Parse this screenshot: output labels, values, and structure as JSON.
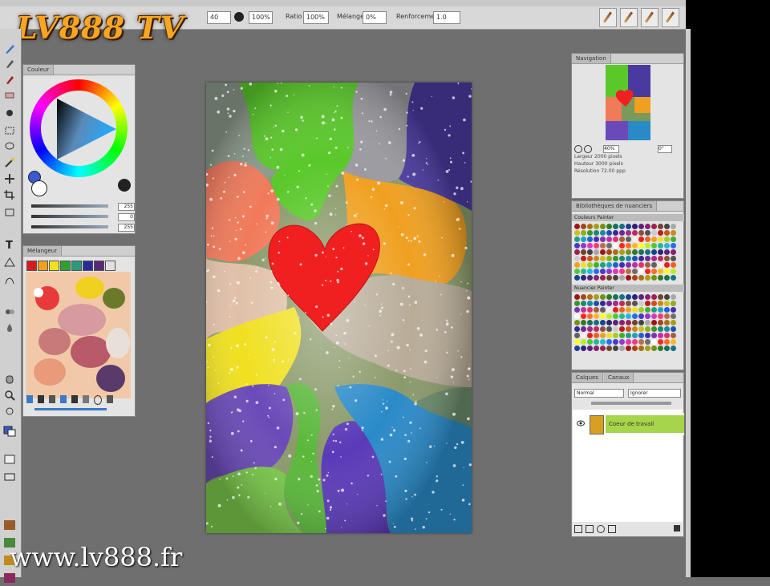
{
  "branding": {
    "logo_text": "LV888 TV",
    "watermark_text": "www.lv888.fr"
  },
  "options_bar": {
    "brush_size": "40",
    "opacity": "100%",
    "ratio_label": "Ratio",
    "ratio_value": "100%",
    "blend_label": "Mélange",
    "blend_value": "0%",
    "smoothing_label": "Renforcement",
    "smoothing_value": "1.0"
  },
  "color_panel": {
    "tab": "Couleur",
    "sliders": [
      "255",
      "0",
      "255"
    ]
  },
  "mixer_panel": {
    "tab": "Mélangeur",
    "swatches": [
      "#d81a1a",
      "#f0a020",
      "#f0e020",
      "#30a030",
      "#2a9a7a",
      "#2a2a9a",
      "#5a2a7a",
      "#e0e0e0"
    ]
  },
  "navigator_panel": {
    "tab": "Navigation",
    "zoom": "40%",
    "rotation": "0°",
    "info": [
      "Largeur  2000 pixels",
      "Hauteur  3000 pixels",
      "Résolution  72.00 ppp"
    ]
  },
  "palette_panel": {
    "tab": "Bibliothèques de nuanciers",
    "sections": [
      "Couleurs Painter",
      "Nuancier Painter"
    ]
  },
  "layers_panel": {
    "tabs": [
      "Calques",
      "Canaux"
    ],
    "mode": "Normal",
    "composite": "Ignorer",
    "layer_name": "Coeur de travail"
  },
  "colors": {
    "app_bg": "#6f6f6f",
    "heart": "#f02020",
    "layer_highlight": "#a6d44a",
    "logo": "#f6a623"
  }
}
